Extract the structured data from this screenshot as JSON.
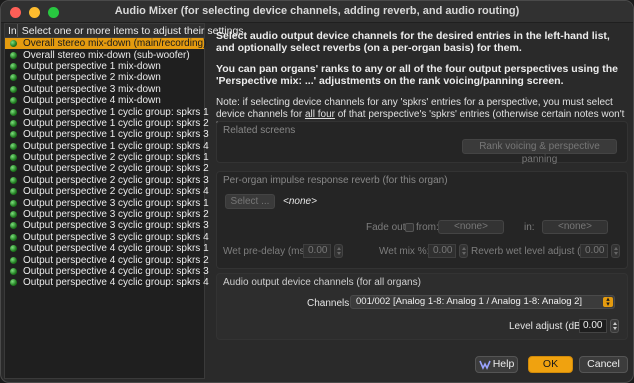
{
  "window": {
    "title": "Audio Mixer (for selecting device channels, adding reverb, and audio routing)"
  },
  "list": {
    "col_in": "In",
    "col_desc": "Select one or more items to adjust their settings",
    "items": [
      "Overall stereo mix-down (main/recording)",
      "Overall stereo mix-down (sub-woofer)",
      "Output perspective 1 mix-down",
      "Output perspective 2 mix-down",
      "Output perspective 3 mix-down",
      "Output perspective 4 mix-down",
      "Output perspective 1 cyclic group: spkrs 1",
      "Output perspective 1 cyclic group: spkrs 2",
      "Output perspective 1 cyclic group: spkrs 3",
      "Output perspective 1 cyclic group: spkrs 4",
      "Output perspective 2 cyclic group: spkrs 1",
      "Output perspective 2 cyclic group: spkrs 2",
      "Output perspective 2 cyclic group: spkrs 3",
      "Output perspective 2 cyclic group: spkrs 4",
      "Output perspective 3 cyclic group: spkrs 1",
      "Output perspective 3 cyclic group: spkrs 2",
      "Output perspective 3 cyclic group: spkrs 3",
      "Output perspective 3 cyclic group: spkrs 4",
      "Output perspective 4 cyclic group: spkrs 1",
      "Output perspective 4 cyclic group: spkrs 2",
      "Output perspective 4 cyclic group: spkrs 3",
      "Output perspective 4 cyclic group: spkrs 4"
    ]
  },
  "info": {
    "para1": "Select audio output device channels for the desired entries in the left-hand list, and optionally select reverbs (on a per-organ basis) for them.",
    "para2": "You can pan organs' ranks to any or all of the four output perspectives using the 'Perspective mix: ...' adjustments on the rank voicing/panning screen.",
    "para3_pre": "Note: if selecting device channels for any 'spkrs' entries for a perspective, you must select device channels for ",
    "para3_u": "all four",
    "para3_post": " of that perspective's 'spkrs' entries (otherwise certain notes won't be audible in ranks routed to that perspective)."
  },
  "related": {
    "label": "Related screens",
    "button": "Rank voicing & perspective panning"
  },
  "reverb": {
    "label": "Per-organ impulse response reverb (for this organ)",
    "select_button": "Select ...",
    "current": "<none>",
    "fade_out_label": "Fade out?",
    "from_label": "from:",
    "from_value": "<none>",
    "in_label": "in:",
    "in_value": "<none>",
    "wet_predelay_label": "Wet pre-delay (ms):",
    "wet_predelay_value": "0.00",
    "wet_mix_label": "Wet mix %:",
    "wet_mix_value": "0.00",
    "wet_level_label": "Reverb wet level adjust (dB):",
    "wet_level_value": "0.00"
  },
  "output": {
    "label": "Audio output device channels (for all organs)",
    "channels_label": "Channels:",
    "channels_value": "001/002 [Analog 1-8: Analog 1 /  Analog 1-8: Analog 2]",
    "level_label": "Level adjust (dB):",
    "level_value": "0.00"
  },
  "footer": {
    "help": "Help",
    "ok": "OK",
    "cancel": "Cancel"
  },
  "colors": {
    "accent": "#e49b0f",
    "ok": "#f0a20f",
    "active_dot": "#3cb43c"
  }
}
